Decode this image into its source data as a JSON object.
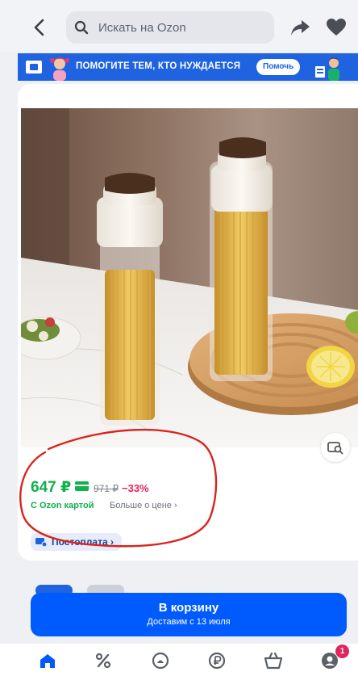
{
  "search": {
    "placeholder": "Искать на Ozon"
  },
  "banner": {
    "text": "ПОМОГИТЕ ТЕМ, КТО НУЖДАЕТСЯ",
    "button": "Помочь"
  },
  "product": {
    "price": "647 ₽",
    "old_price": "971 ₽",
    "discount": "−33%",
    "card_label": "С Ozon картой",
    "more_price": "Больше о цене ›"
  },
  "postpay": {
    "label": "Постоплата ›"
  },
  "cart_button": {
    "label": "В корзину",
    "sub": "Доставим с 13 июля"
  },
  "tabbar": {
    "profile_badge": "1"
  },
  "colors": {
    "accent": "#005bff",
    "price_green": "#10b04d",
    "discount": "#e0245e",
    "banner": "#1f63e0",
    "annotation": "#d9241f"
  }
}
